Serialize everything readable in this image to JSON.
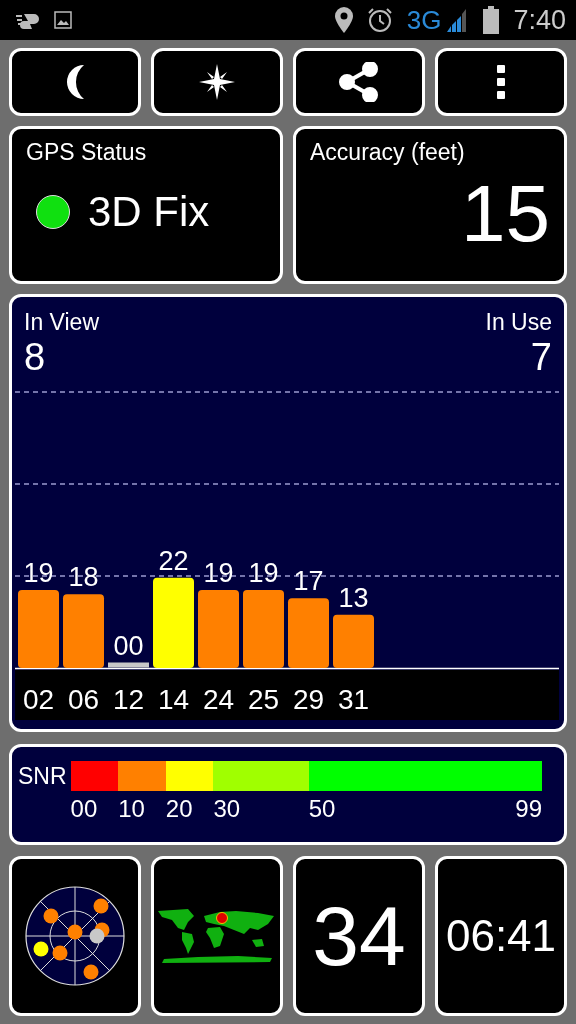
{
  "status_bar": {
    "network": "3G",
    "time": "7:40"
  },
  "toolbar": {
    "buttons": [
      {
        "kind": "night"
      },
      {
        "kind": "compass"
      },
      {
        "kind": "share"
      },
      {
        "kind": "more"
      }
    ]
  },
  "gps_status": {
    "label": "GPS Status",
    "value": "3D Fix",
    "color": "#10e010"
  },
  "accuracy": {
    "label": "Accuracy (feet)",
    "value": "15"
  },
  "satellites": {
    "in_view_label": "In View",
    "in_view": "8",
    "in_use_label": "In Use",
    "in_use": "7",
    "chart_data": {
      "type": "bar",
      "categories": [
        "02",
        "06",
        "12",
        "14",
        "24",
        "25",
        "29",
        "31"
      ],
      "values": [
        19,
        18,
        0,
        22,
        19,
        19,
        17,
        13
      ],
      "value_labels": [
        "19",
        "18",
        "00",
        "22",
        "19",
        "19",
        "17",
        "13"
      ]
    }
  },
  "snr_legend": {
    "label": "SNR",
    "segments": [
      {
        "label": "00",
        "color": "#ff0000"
      },
      {
        "label": "10",
        "color": "#ff8000"
      },
      {
        "label": "20",
        "color": "#ffff00"
      },
      {
        "label": "30",
        "color": "#a0ff00"
      },
      {
        "label": "50",
        "color": "#00ff00"
      }
    ],
    "end_label": "99"
  },
  "tiles": [
    {
      "kind": "radar"
    },
    {
      "kind": "map"
    },
    {
      "kind": "number",
      "text": "34"
    },
    {
      "kind": "clock",
      "text": "06:41"
    }
  ]
}
